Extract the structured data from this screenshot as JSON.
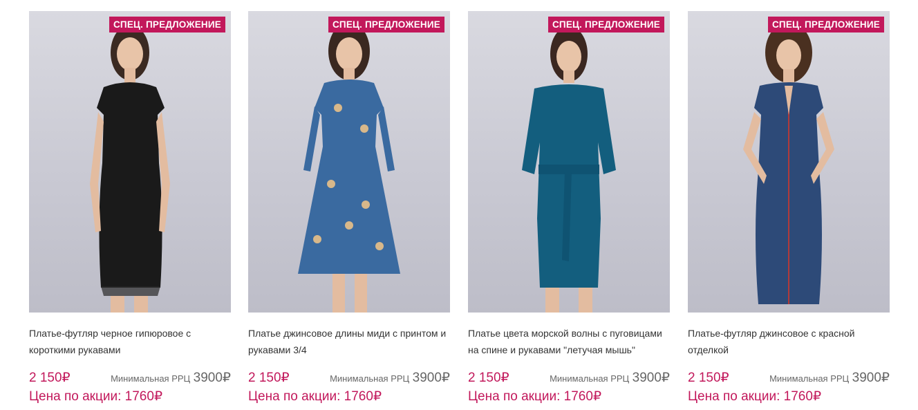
{
  "badge_text": "СПЕЦ. ПРЕДЛОЖЕНИЕ",
  "currency": "₽",
  "products": [
    {
      "title": "Платье-футляр черное гипюровое с короткими рукавами",
      "price": "2 150",
      "rrp_label": "Минимальная РРЦ",
      "rrp_value": "3900",
      "promo_label": "Цена по акции:",
      "promo_value": "1760",
      "dress_color": "#1a1a1a",
      "photo_type": "black-sheath-dress"
    },
    {
      "title": "Платье джинсовое длины миди с принтом и рукавами 3/4",
      "price": "2 150",
      "rrp_label": "Минимальная РРЦ",
      "rrp_value": "3900",
      "promo_label": "Цена по акции:",
      "promo_value": "1760",
      "dress_color": "#3a6aa0",
      "photo_type": "denim-print-midi-dress"
    },
    {
      "title": "Платье цвета морской волны с пуговицами на спине и рукавами \"летучая мышь\"",
      "price": "2 150",
      "rrp_label": "Минимальная РРЦ",
      "rrp_value": "3900",
      "promo_label": "Цена по акции:",
      "promo_value": "1760",
      "dress_color": "#135e7e",
      "photo_type": "teal-belted-dress"
    },
    {
      "title": "Платье-футляр джинсовое с красной отделкой",
      "price": "2 150",
      "rrp_label": "Минимальная РРЦ",
      "rrp_value": "3900",
      "promo_label": "Цена по акции:",
      "promo_value": "1760",
      "dress_color": "#2d4a78",
      "photo_type": "denim-sheath-red-trim"
    }
  ]
}
